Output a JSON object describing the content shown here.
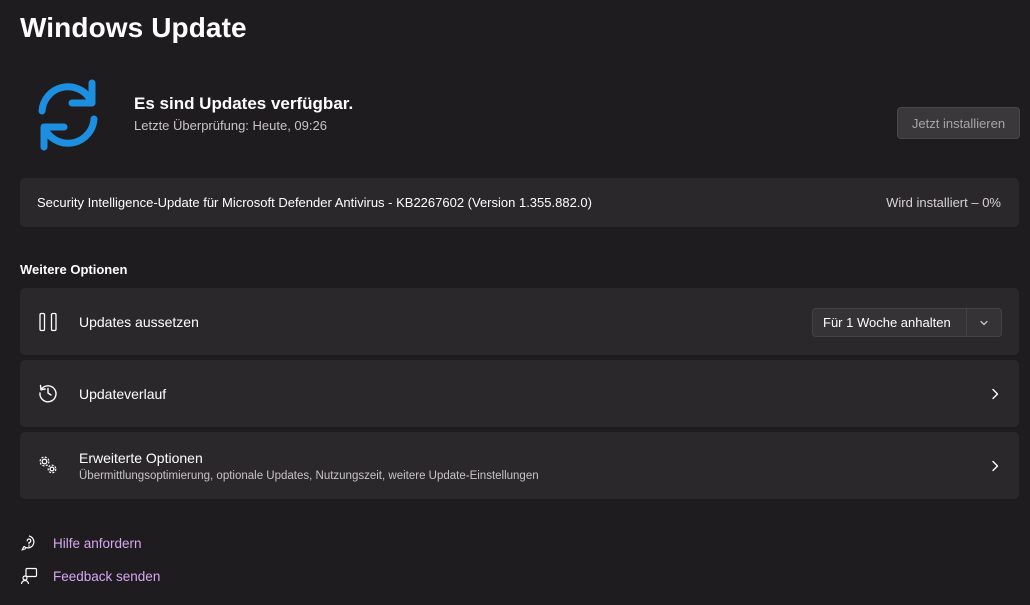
{
  "page": {
    "title": "Windows Update"
  },
  "status": {
    "headline": "Es sind Updates verfügbar.",
    "last_check": "Letzte Überprüfung: Heute, 09:26",
    "install_button": "Jetzt installieren",
    "icon": "sync-icon",
    "accent_color": "#1d8fe0"
  },
  "pending_update": {
    "name": "Security Intelligence-Update für Microsoft Defender Antivirus - KB2267602 (Version 1.355.882.0)",
    "status": "Wird installiert – 0%",
    "progress_percent": 0
  },
  "options": {
    "section_title": "Weitere Optionen",
    "pause": {
      "label": "Updates aussetzen",
      "icon": "pause-icon",
      "dropdown_value": "Für 1 Woche anhalten"
    },
    "history": {
      "label": "Updateverlauf",
      "icon": "history-icon"
    },
    "advanced": {
      "label": "Erweiterte Optionen",
      "description": "Übermittlungsoptimierung, optionale Updates, Nutzungszeit, weitere Update-Einstellungen",
      "icon": "gears-icon"
    }
  },
  "links": {
    "help": {
      "label": "Hilfe anfordern",
      "icon": "help-icon"
    },
    "feedback": {
      "label": "Feedback senden",
      "icon": "feedback-icon"
    },
    "link_color": "#d4a8f0"
  }
}
